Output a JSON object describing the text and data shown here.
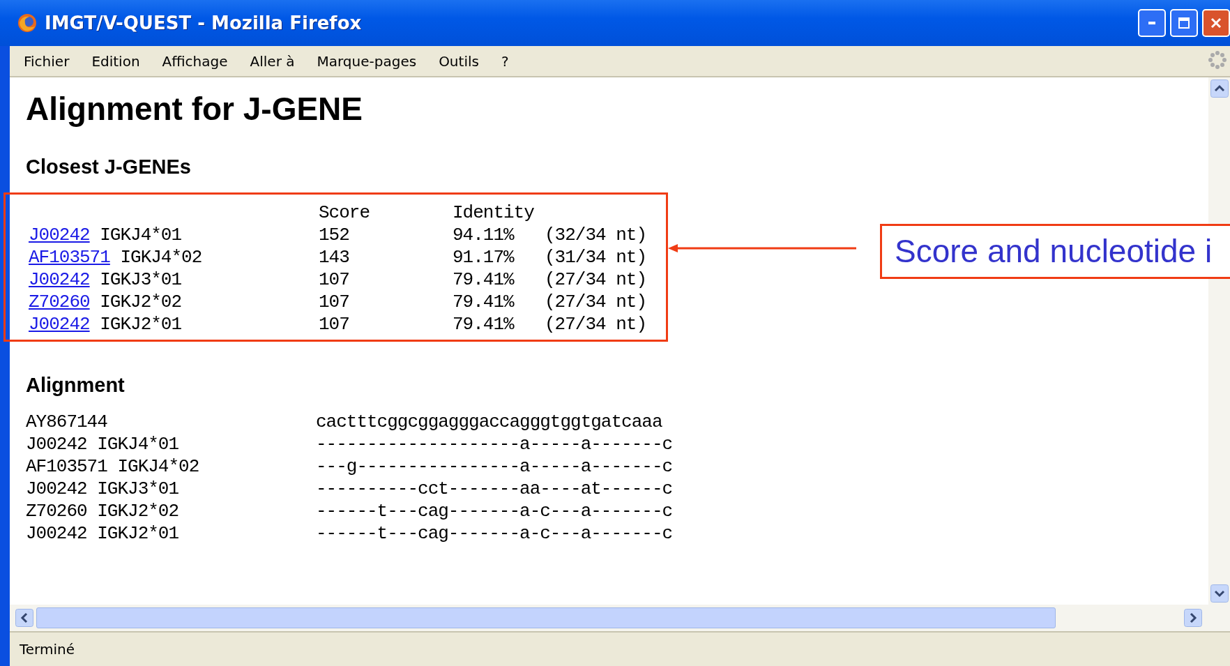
{
  "window": {
    "title": "IMGT/V-QUEST - Mozilla Firefox"
  },
  "menu": [
    "Fichier",
    "Edition",
    "Affichage",
    "Aller à",
    "Marque-pages",
    "Outils",
    "?"
  ],
  "page": {
    "title": "Alignment for J-GENE",
    "closest": {
      "heading": "Closest J-GENEs",
      "columns": [
        "Score",
        "Identity"
      ],
      "rows": [
        {
          "accession": "J00242",
          "gene": "IGKJ4*01",
          "score": "152",
          "identity": "94.11%",
          "nt": "(32/34 nt)"
        },
        {
          "accession": "AF103571",
          "gene": "IGKJ4*02",
          "score": "143",
          "identity": "91.17%",
          "nt": "(31/34 nt)"
        },
        {
          "accession": "J00242",
          "gene": "IGKJ3*01",
          "score": "107",
          "identity": "79.41%",
          "nt": "(27/34 nt)"
        },
        {
          "accession": "Z70260",
          "gene": "IGKJ2*02",
          "score": "107",
          "identity": "79.41%",
          "nt": "(27/34 nt)"
        },
        {
          "accession": "J00242",
          "gene": "IGKJ2*01",
          "score": "107",
          "identity": "79.41%",
          "nt": "(27/34 nt)"
        }
      ]
    },
    "alignment": {
      "heading": "Alignment",
      "rows": [
        {
          "name": "AY867144",
          "sequence": "cactttcggcggagggaccagggtggtgatcaaa"
        },
        {
          "name": "J00242 IGKJ4*01",
          "sequence": "--------------------a-----a-------c"
        },
        {
          "name": "AF103571 IGKJ4*02",
          "sequence": "---g----------------a-----a-------c"
        },
        {
          "name": "J00242 IGKJ3*01",
          "sequence": "----------cct-------aa----at------c"
        },
        {
          "name": "Z70260 IGKJ2*02",
          "sequence": "------t---cag-------a-c---a-------c"
        },
        {
          "name": "J00242 IGKJ2*01",
          "sequence": "------t---cag-------a-c---a-------c"
        }
      ]
    }
  },
  "callout": {
    "text": "Score and nucleotide i"
  },
  "status_bar": {
    "text": "Terminé"
  }
}
